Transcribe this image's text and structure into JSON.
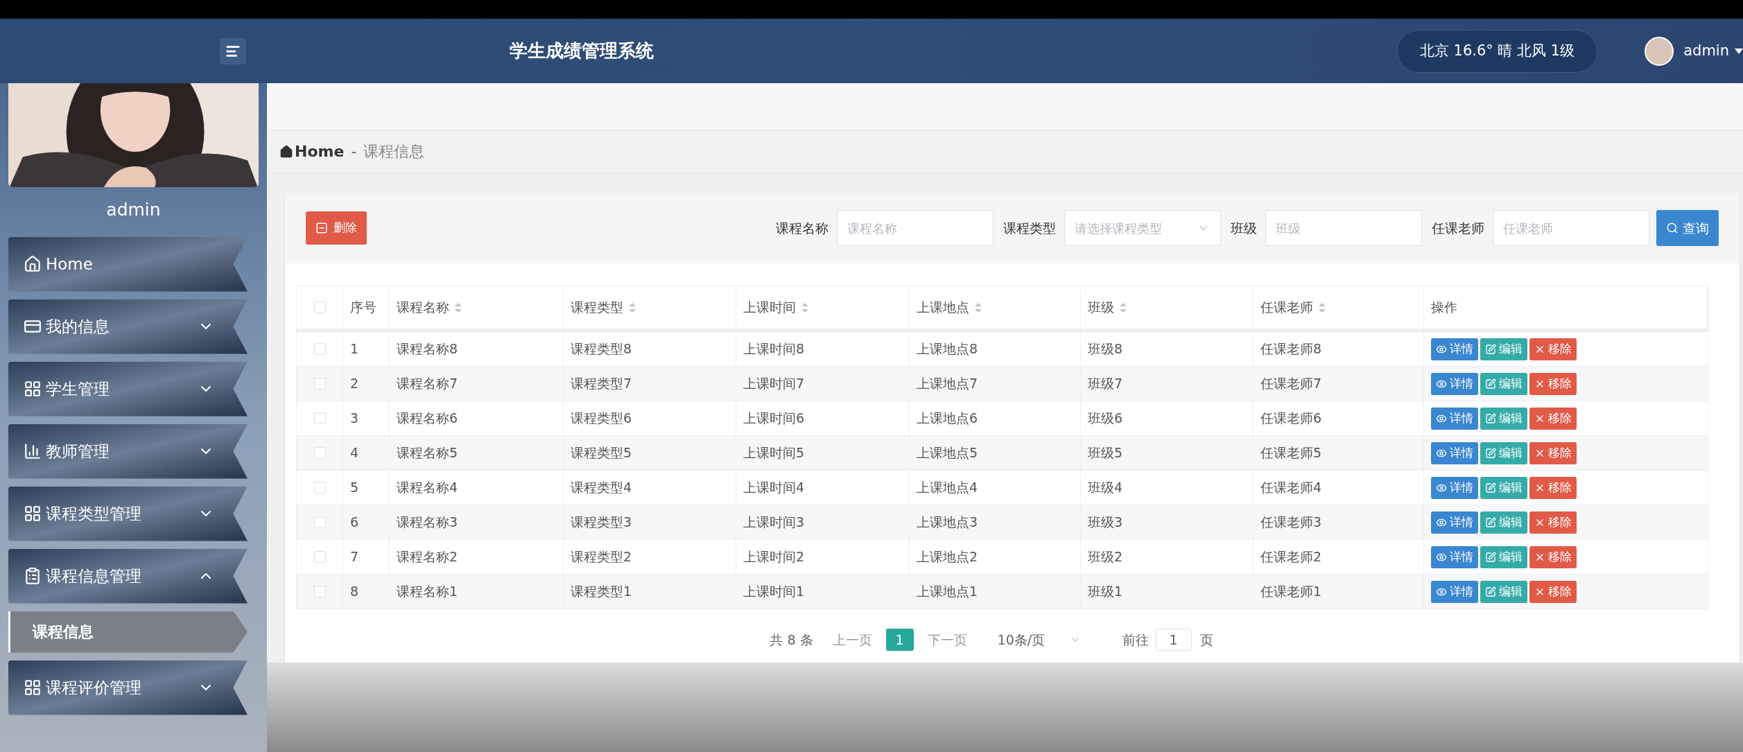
{
  "header": {
    "title": "学生成绩管理系统",
    "weather": "北京 16.6° 晴 北风 1级",
    "user": "admin"
  },
  "sidebar": {
    "username": "admin",
    "menu": [
      {
        "label": "Home",
        "kind": "link"
      },
      {
        "label": "我的信息",
        "kind": "group",
        "expanded": false
      },
      {
        "label": "学生管理",
        "kind": "group",
        "expanded": false
      },
      {
        "label": "教师管理",
        "kind": "group",
        "expanded": false
      },
      {
        "label": "课程类型管理",
        "kind": "group",
        "expanded": false
      },
      {
        "label": "课程信息管理",
        "kind": "group",
        "expanded": true,
        "children": [
          {
            "label": "课程信息",
            "selected": true
          }
        ]
      },
      {
        "label": "课程评价管理",
        "kind": "group",
        "expanded": false
      }
    ]
  },
  "breadcrumb": {
    "home": "Home",
    "separator": "-",
    "current": "课程信息"
  },
  "toolbar": {
    "delete_button": "删除",
    "filters": [
      {
        "label": "课程名称",
        "kind": "input",
        "placeholder": "课程名称"
      },
      {
        "label": "课程类型",
        "kind": "select",
        "placeholder": "请选择课程类型"
      },
      {
        "label": "班级",
        "kind": "input",
        "placeholder": "班级"
      },
      {
        "label": "任课老师",
        "kind": "input",
        "placeholder": "任课老师"
      }
    ],
    "search_button": "查询"
  },
  "table": {
    "select_all": {
      "checked": false
    },
    "columns": [
      {
        "label": "序号",
        "sortable": false
      },
      {
        "label": "课程名称",
        "sortable": true
      },
      {
        "label": "课程类型",
        "sortable": true
      },
      {
        "label": "上课时间",
        "sortable": true
      },
      {
        "label": "上课地点",
        "sortable": true
      },
      {
        "label": "班级",
        "sortable": true
      },
      {
        "label": "任课老师",
        "sortable": true
      },
      {
        "label": "操作",
        "sortable": false
      }
    ],
    "rows": [
      {
        "checked": false,
        "cells": [
          "1",
          "课程名称8",
          "课程类型8",
          "上课时间8",
          "上课地点8",
          "班级8",
          "任课老师8"
        ],
        "actions": [
          "详情",
          "编辑",
          "移除"
        ]
      },
      {
        "checked": false,
        "cells": [
          "2",
          "课程名称7",
          "课程类型7",
          "上课时间7",
          "上课地点7",
          "班级7",
          "任课老师7"
        ],
        "actions": [
          "详情",
          "编辑",
          "移除"
        ]
      },
      {
        "checked": false,
        "cells": [
          "3",
          "课程名称6",
          "课程类型6",
          "上课时间6",
          "上课地点6",
          "班级6",
          "任课老师6"
        ],
        "actions": [
          "详情",
          "编辑",
          "移除"
        ]
      },
      {
        "checked": false,
        "cells": [
          "4",
          "课程名称5",
          "课程类型5",
          "上课时间5",
          "上课地点5",
          "班级5",
          "任课老师5"
        ],
        "actions": [
          "详情",
          "编辑",
          "移除"
        ]
      },
      {
        "checked": false,
        "cells": [
          "5",
          "课程名称4",
          "课程类型4",
          "上课时间4",
          "上课地点4",
          "班级4",
          "任课老师4"
        ],
        "actions": [
          "详情",
          "编辑",
          "移除"
        ]
      },
      {
        "checked": false,
        "cells": [
          "6",
          "课程名称3",
          "课程类型3",
          "上课时间3",
          "上课地点3",
          "班级3",
          "任课老师3"
        ],
        "actions": [
          "详情",
          "编辑",
          "移除"
        ]
      },
      {
        "checked": false,
        "cells": [
          "7",
          "课程名称2",
          "课程类型2",
          "上课时间2",
          "上课地点2",
          "班级2",
          "任课老师2"
        ],
        "actions": [
          "详情",
          "编辑",
          "移除"
        ]
      },
      {
        "checked": false,
        "cells": [
          "8",
          "课程名称1",
          "课程类型1",
          "上课时间1",
          "上课地点1",
          "班级1",
          "任课老师1"
        ],
        "actions": [
          "详情",
          "编辑",
          "移除"
        ]
      }
    ]
  },
  "pagination": {
    "total": "共 8 条",
    "prev": "上一页",
    "pages": [
      {
        "label": "1",
        "selected": true
      }
    ],
    "next": "下一页",
    "page_size": "10条/页",
    "goto_label": "前往",
    "goto_value": "1",
    "goto_suffix": "页"
  }
}
